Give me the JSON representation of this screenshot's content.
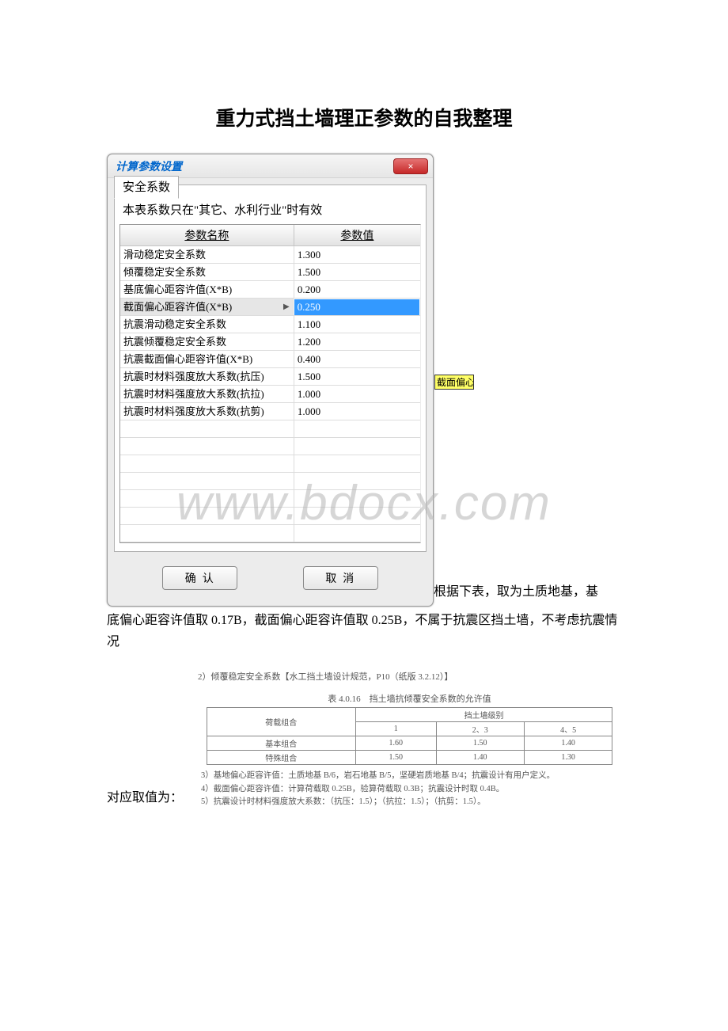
{
  "page": {
    "title": "重力式挡土墙理正参数的自我整理",
    "para1_prefix": "根据下表，取为土质地基，基",
    "para2": "底偏心距容许值取 0.17B，截面偏心距容许值取 0.25B，不属于抗震区挡土墙，不考虑抗震情况",
    "para_bottom": "对应取值为：",
    "watermark": "www.bdocx.com"
  },
  "dialog": {
    "title": "计算参数设置",
    "close_glyph": "×",
    "tab_label": "安全系数",
    "note_line": "本表系数只在\"其它、水利行业\"时有效",
    "header_name": "参数名称",
    "header_value": "参数值",
    "yellow_tip": "截面偏心距",
    "ok_label": "确认",
    "cancel_label": "取消",
    "rows": [
      {
        "name": "滑动稳定安全系数",
        "value": "1.300",
        "selected": false
      },
      {
        "name": "倾覆稳定安全系数",
        "value": "1.500",
        "selected": false
      },
      {
        "name": "基底偏心距容许值(X*B)",
        "value": "0.200",
        "selected": false
      },
      {
        "name": "截面偏心距容许值(X*B)",
        "value": "0.250",
        "selected": true
      },
      {
        "name": "抗震滑动稳定安全系数",
        "value": "1.100",
        "selected": false
      },
      {
        "name": "抗震倾覆稳定安全系数",
        "value": "1.200",
        "selected": false
      },
      {
        "name": "抗震截面偏心距容许值(X*B)",
        "value": "0.400",
        "selected": false
      },
      {
        "name": "抗震时材料强度放大系数(抗压)",
        "value": "1.500",
        "selected": false
      },
      {
        "name": "抗震时材料强度放大系数(抗拉)",
        "value": "1.000",
        "selected": false
      },
      {
        "name": "抗震时材料强度放大系数(抗剪)",
        "value": "1.000",
        "selected": false
      }
    ],
    "blank_rows": 7
  },
  "spec": {
    "caption2": "2）倾覆稳定安全系数【水工挡土墙设计规范，P10（纸版 3.2.12）】",
    "table_title": "表 4.0.16　挡土墙抗倾覆安全系数的允许值",
    "header_left": "荷载组合",
    "header_top": "挡土墙级别",
    "cols": [
      "1",
      "2、3",
      "4、5"
    ],
    "rows": [
      {
        "label": "基本组合",
        "vals": [
          "1.60",
          "1.50",
          "1.40"
        ]
      },
      {
        "label": "特殊组合",
        "vals": [
          "1.50",
          "1.40",
          "1.30"
        ]
      }
    ],
    "note3": "3）基地偏心距容许值：土质地基 B/6，岩石地基 B/5，坚硬岩质地基 B/4；抗震设计有用户定义。",
    "note4": "4）截面偏心距容许值：计算荷载取 0.25B，验算荷载取 0.3B；抗震设计时取 0.4B。",
    "note5": "5）抗震设计时材料强度放大系数：（抗压：1.5）；（抗拉：1.5）；（抗剪：1.5）。"
  }
}
